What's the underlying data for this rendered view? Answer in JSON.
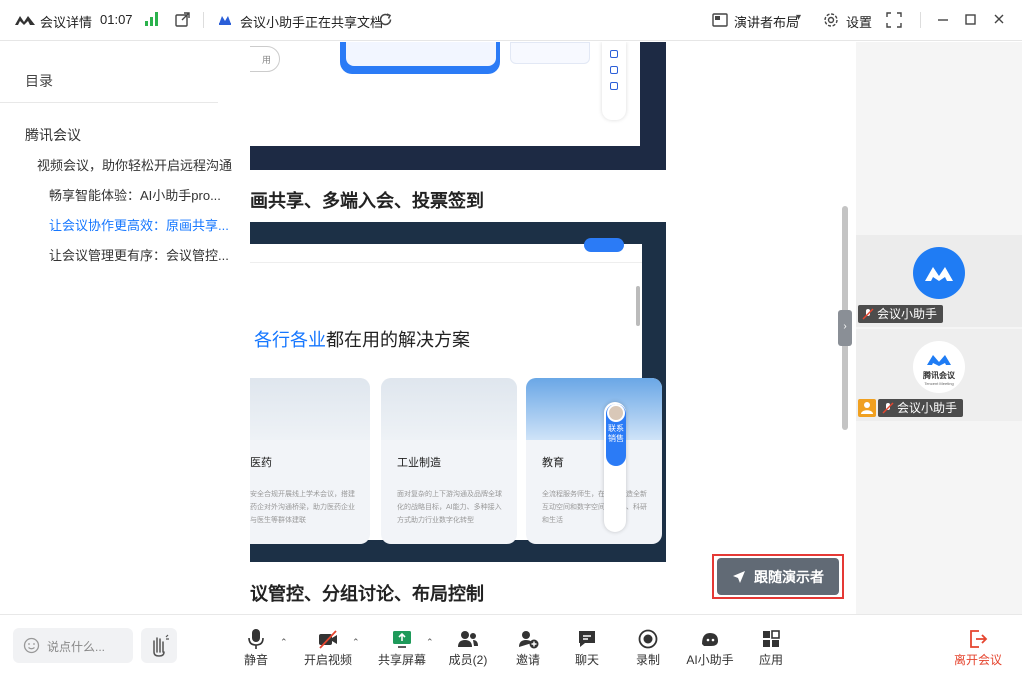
{
  "titlebar": {
    "meeting_details": "会议详情",
    "elapsed_time": "01:07",
    "share_status": "会议小助手正在共享文档",
    "layout_label": "演讲者布局",
    "settings_label": "设置"
  },
  "toc": {
    "title": "目录",
    "items": [
      {
        "label": "腾讯会议",
        "level": 1,
        "active": false
      },
      {
        "label": "视频会议，助你轻松开启远程沟通",
        "level": 2,
        "active": false
      },
      {
        "label": "畅享智能体验：AI小助手pro...",
        "level": 3,
        "active": false
      },
      {
        "label": "让会议协作更高效：原画共享...",
        "level": 3,
        "active": true
      },
      {
        "label": "让会议管理更有序：会议管控...",
        "level": 3,
        "active": false
      }
    ]
  },
  "document": {
    "pill_button_text": "用",
    "heading_1": "画共享、多端入会、投票签到",
    "solutions_highlight": "各行各业",
    "solutions_rest": "都在用的解决方案",
    "cards": [
      {
        "label": "医药",
        "desc": "安全合规开展线上学术会议，搭建药企对外沟通桥梁，助力医药企业与医生等群体建联"
      },
      {
        "label": "工业制造",
        "desc": "面对复杂的上下游沟通及品牌全球化的战略目标，AI能力、多种接入方式助力行业数字化转型"
      },
      {
        "label": "教育",
        "desc": "全流程服务师生，在校园打造全新互动空间和数字空间的教学、科研和生活"
      }
    ],
    "contact_label": "联系销售",
    "heading_2": "议管控、分组讨论、布局控制"
  },
  "follow_button": {
    "label": "跟随演示者"
  },
  "participants": [
    {
      "name": "会议小助手",
      "avatar": "tencent-meeting-blue-logo",
      "host": false
    },
    {
      "name": "会议小助手",
      "avatar": "tencent-meeting-white-logo",
      "avatar_text": "腾讯会议",
      "avatar_subtext": "Tencent Meeting",
      "host": true
    }
  ],
  "toolbar": {
    "chat_placeholder": "说点什么...",
    "mute": "静音",
    "video": "开启视频",
    "share": "共享屏幕",
    "members": "成员(2)",
    "invite": "邀请",
    "chat": "聊天",
    "record": "录制",
    "ai": "AI小助手",
    "apps": "应用",
    "leave": "离开会议"
  },
  "colors": {
    "accent": "#1677ff",
    "signal": "#2bb24c",
    "leave": "#e5452f",
    "highlight_frame": "#e53935"
  }
}
